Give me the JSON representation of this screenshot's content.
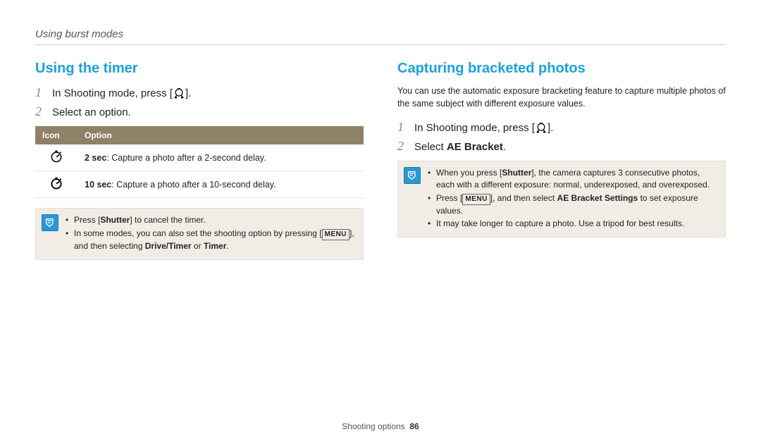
{
  "breadcrumb": "Using burst modes",
  "left": {
    "heading": "Using the timer",
    "steps": [
      {
        "num": "1",
        "pre": "In Shooting mode, press [",
        "post": "]."
      },
      {
        "num": "2",
        "text": "Select an option."
      }
    ],
    "table": {
      "h_icon": "Icon",
      "h_option": "Option",
      "rows": [
        {
          "bold": "2 sec",
          "text": ": Capture a photo after a 2-second delay."
        },
        {
          "bold": "10 sec",
          "text": ": Capture a photo after a 10-second delay."
        }
      ]
    },
    "note": {
      "b1_pre": "Press [",
      "b1_bold": "Shutter",
      "b1_post": "] to cancel the timer.",
      "b2_pre": "In some modes, you can also set the shooting option by pressing [",
      "b2_post1": "], and then selecting ",
      "b2_bold1": "Drive/Timer",
      "b2_or": " or ",
      "b2_bold2": "Timer",
      "b2_end": "."
    }
  },
  "right": {
    "heading": "Capturing bracketed photos",
    "intro": "You can use the automatic exposure bracketing feature to capture multiple photos of the same subject with different exposure values.",
    "steps": [
      {
        "num": "1",
        "pre": "In Shooting mode, press [",
        "post": "]."
      },
      {
        "num": "2",
        "pre": "Select ",
        "bold": "AE Bracket",
        "post": "."
      }
    ],
    "note": {
      "b1_pre": "When you press [",
      "b1_bold": "Shutter",
      "b1_post": "], the camera captures 3 consecutive photos, each with a different exposure: normal, underexposed, and overexposed.",
      "b2_pre": "Press [",
      "b2_post": "], and then select ",
      "b2_bold": "AE Bracket Settings",
      "b2_end": " to set exposure values.",
      "b3": "It may take longer to capture a photo. Use a tripod for best results."
    }
  },
  "footer": {
    "section": "Shooting options",
    "page": "86"
  },
  "labels": {
    "menu": "MENU"
  }
}
